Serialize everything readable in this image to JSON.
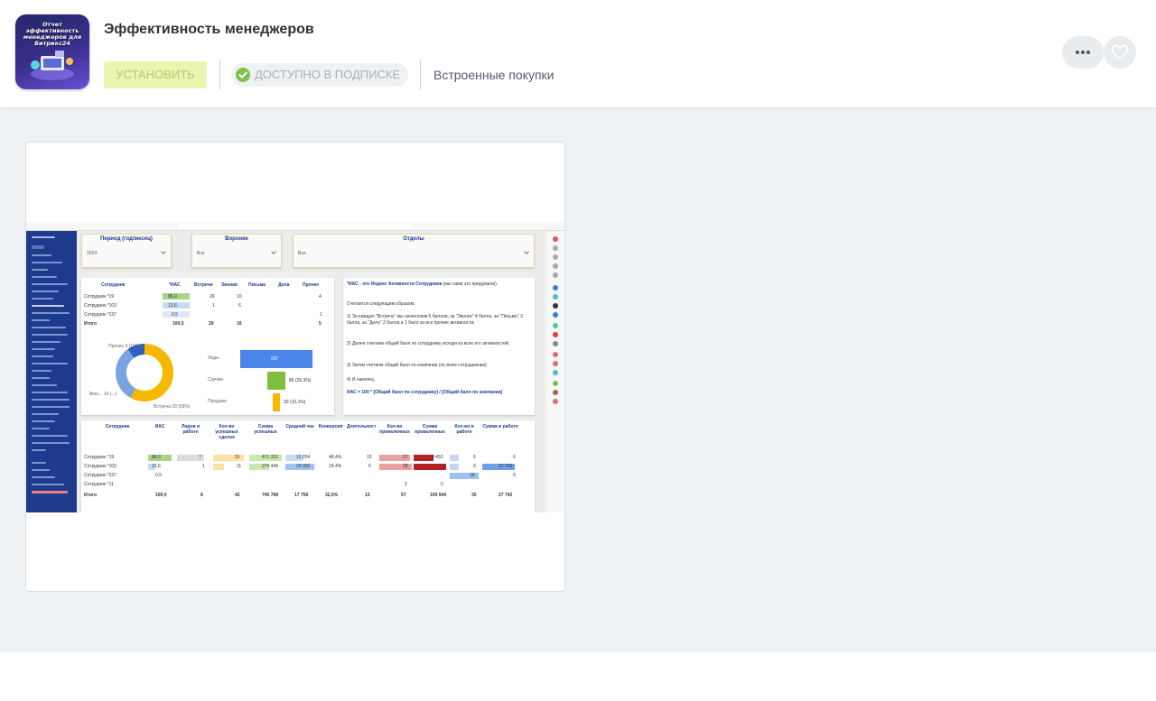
{
  "app": {
    "title": "Эффективность менеджеров",
    "logo_text": "Отчет эффективность менеджеров для Битрикс24",
    "install_label": "Установить",
    "subscription_label": "Доступно в подписке",
    "inapp_label": "Встроенные покупки"
  },
  "colors": {
    "install_bg": "#e8f6b0",
    "install_text": "#b8c96e",
    "check_green": "#7fc24a",
    "gallery_bg": "#eef2f4"
  },
  "icons": {
    "more": "more-dots-icon",
    "favorite": "heart-icon",
    "check": "check-circle-icon"
  },
  "screenshot": {
    "filters": [
      {
        "label": "Период (год/месяц)",
        "value": "2024"
      },
      {
        "label": "Воронки",
        "value": "Все"
      },
      {
        "label": "Отделы",
        "value": "Все"
      }
    ],
    "table1": {
      "headers": [
        "Сотрудник",
        "*ИАС",
        "Встречи",
        "Звонки",
        "Письма",
        "Дела",
        "Прочее"
      ],
      "rows": [
        [
          "Сотрудник *19",
          "86,0",
          "26",
          "10",
          "",
          "",
          "4"
        ],
        [
          "Сотрудник *103",
          "13,6",
          "1",
          "6",
          "",
          "",
          ""
        ],
        [
          "Сотрудник *237",
          "0,5",
          "",
          "",
          "",
          "",
          "1"
        ],
        [
          "Итого",
          "100,0",
          "29",
          "16",
          "",
          "",
          "5"
        ]
      ]
    },
    "donut": {
      "labels": [
        "Прочее 5 (10%)",
        "Звон... 16 (...)",
        "Встреча 29 (58%)"
      ],
      "values": [
        10,
        32,
        58
      ]
    },
    "funnel": {
      "labels": [
        "Лиды",
        "Сделки",
        "Продажи"
      ],
      "values": [
        "297",
        "80 (26,9%)",
        "30 (10,1%)"
      ]
    },
    "info": {
      "title": "*ИАС - это Индекс Активности Сотрудника",
      "title_note": "(мы сами это придумали).",
      "intro": "Считается следующим образом:",
      "p1": "1) За каждую \"Встречу\" мы начисляем 5 баллов, за \"Звонок\" 4 балла, за \"Письмо\" 3 балла, за \"Дело\" 2 балла и 1 балл за все прочие активности;",
      "p2": "2) Далее считаем общий балл по сотруднику исходя из всех его активностей;",
      "p3": "3) Затем считаем общий балл по компании (по всем сотрудникам);",
      "p4": "4) И наконец,",
      "formula": "ИАС = 100 * [Общий балл по сотруднику] / [Общий балл по компании]"
    },
    "table2": {
      "headers": [
        "Сотрудник",
        "ИАС",
        "Лидов в работе",
        "Кол-во успешных сделок",
        "Сумма успешных",
        "Средний чек",
        "Конверсия",
        "Длительность",
        "Кол-во проваленных",
        "Сумма проваленных",
        "Кол-во в работе",
        "Сумма в работе"
      ],
      "rows": [
        [
          "Сотрудник *19",
          "86,0",
          "7",
          "31",
          "471 322",
          "15 204",
          "48,4%",
          "15",
          "27",
          "9 452",
          "6",
          "0"
        ],
        [
          "Сотрудник *103",
          "13,6",
          "1",
          "11",
          "274 446",
          "24 950",
          "24,4%",
          "6",
          "28",
          "",
          "6",
          "27 742"
        ],
        [
          "Сотрудник *237",
          "0,5",
          "",
          "",
          "",
          "",
          "",
          "",
          "",
          "",
          "18",
          "0"
        ],
        [
          "Сотрудник *11",
          "",
          "",
          "",
          "",
          "",
          "",
          "",
          "2",
          "0",
          "",
          ""
        ],
        [
          "Итого",
          "100,0",
          "8",
          "42",
          "745 768",
          "17 756",
          "32,6%",
          "13",
          "57",
          "109 944",
          "30",
          "27 742"
        ]
      ]
    }
  }
}
